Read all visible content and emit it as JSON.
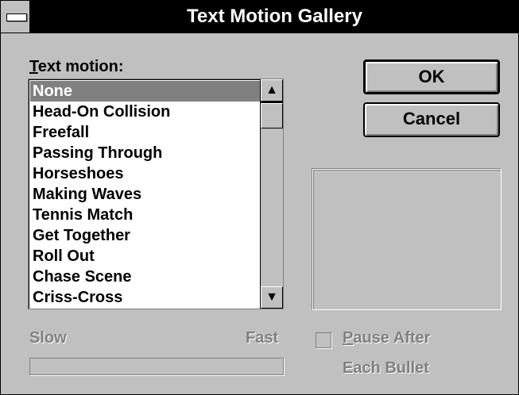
{
  "window": {
    "title": "Text Motion Gallery"
  },
  "label": {
    "text_motion_prefix": "T",
    "text_motion_rest": "ext motion:"
  },
  "list": {
    "selected_index": 0,
    "items": [
      "None",
      "Head-On Collision",
      "Freefall",
      "Passing Through",
      "Horseshoes",
      "Making Waves",
      "Tennis Match",
      "Get Together",
      "Roll Out",
      "Chase Scene",
      "Criss-Cross"
    ]
  },
  "buttons": {
    "ok": "OK",
    "cancel": "Cancel"
  },
  "speed": {
    "slow": "Slow",
    "fast": "Fast"
  },
  "pause": {
    "prefix": "P",
    "line1_rest": "ause After",
    "line2": "Each Bullet",
    "checked": false
  },
  "icons": {
    "scroll_up": "▲",
    "scroll_down": "▼"
  }
}
